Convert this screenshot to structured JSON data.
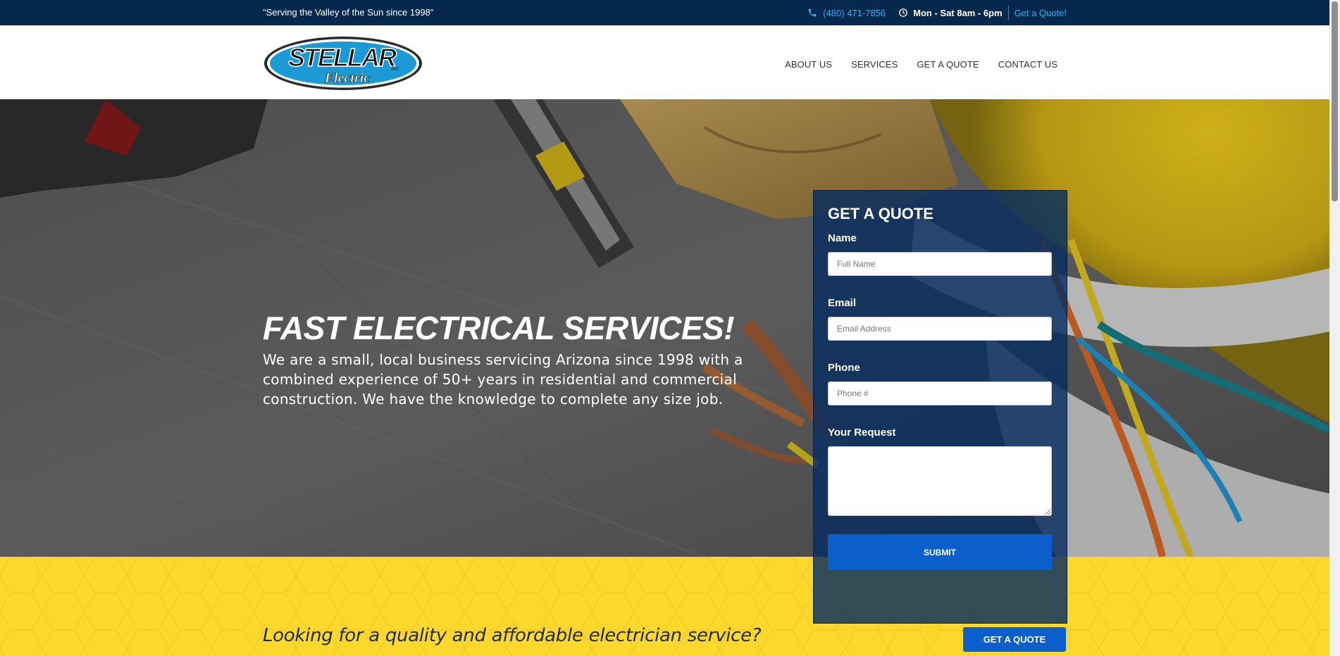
{
  "topbar": {
    "slogan": "\"Serving the Valley of the Sun since 1998\"",
    "phone": "(480) 471-7856",
    "phone_icon": "phone-icon",
    "hours": "Mon - Sat 8am - 6pm",
    "hours_icon": "clock-icon",
    "quote_link": "Get a Quote!"
  },
  "header": {
    "logo": {
      "wordmark": "STELLAR",
      "suffix": "Inc",
      "subtitle": "Electric"
    },
    "nav": [
      {
        "label": "ABOUT US"
      },
      {
        "label": "SERVICES"
      },
      {
        "label": "GET A QUOTE"
      },
      {
        "label": "CONTACT US"
      }
    ]
  },
  "hero": {
    "title": "FAST ELECTRICAL SERVICES!",
    "text": "We are a small, local business servicing Arizona since 1998 with a combined experience of 50+ years in residential and commercial construction. We have the knowledge to complete any size job."
  },
  "quote_form": {
    "title": "GET A QUOTE",
    "name_label": "Name",
    "name_placeholder": "Full Name",
    "email_label": "Email",
    "email_placeholder": "Email Address",
    "phone_label": "Phone",
    "phone_placeholder": "Phone #",
    "request_label": "Your Request",
    "submit_label": "SUBMIT"
  },
  "band": {
    "text": "Looking for a quality and affordable electrician service?",
    "button_label": "GET A QUOTE"
  },
  "colors": {
    "topbar_bg": "#07284d",
    "accent_blue": "#2ab0ee",
    "button_blue": "#0a5fcc",
    "band_yellow": "#fdd82c",
    "form_bg": "#062d5f"
  }
}
